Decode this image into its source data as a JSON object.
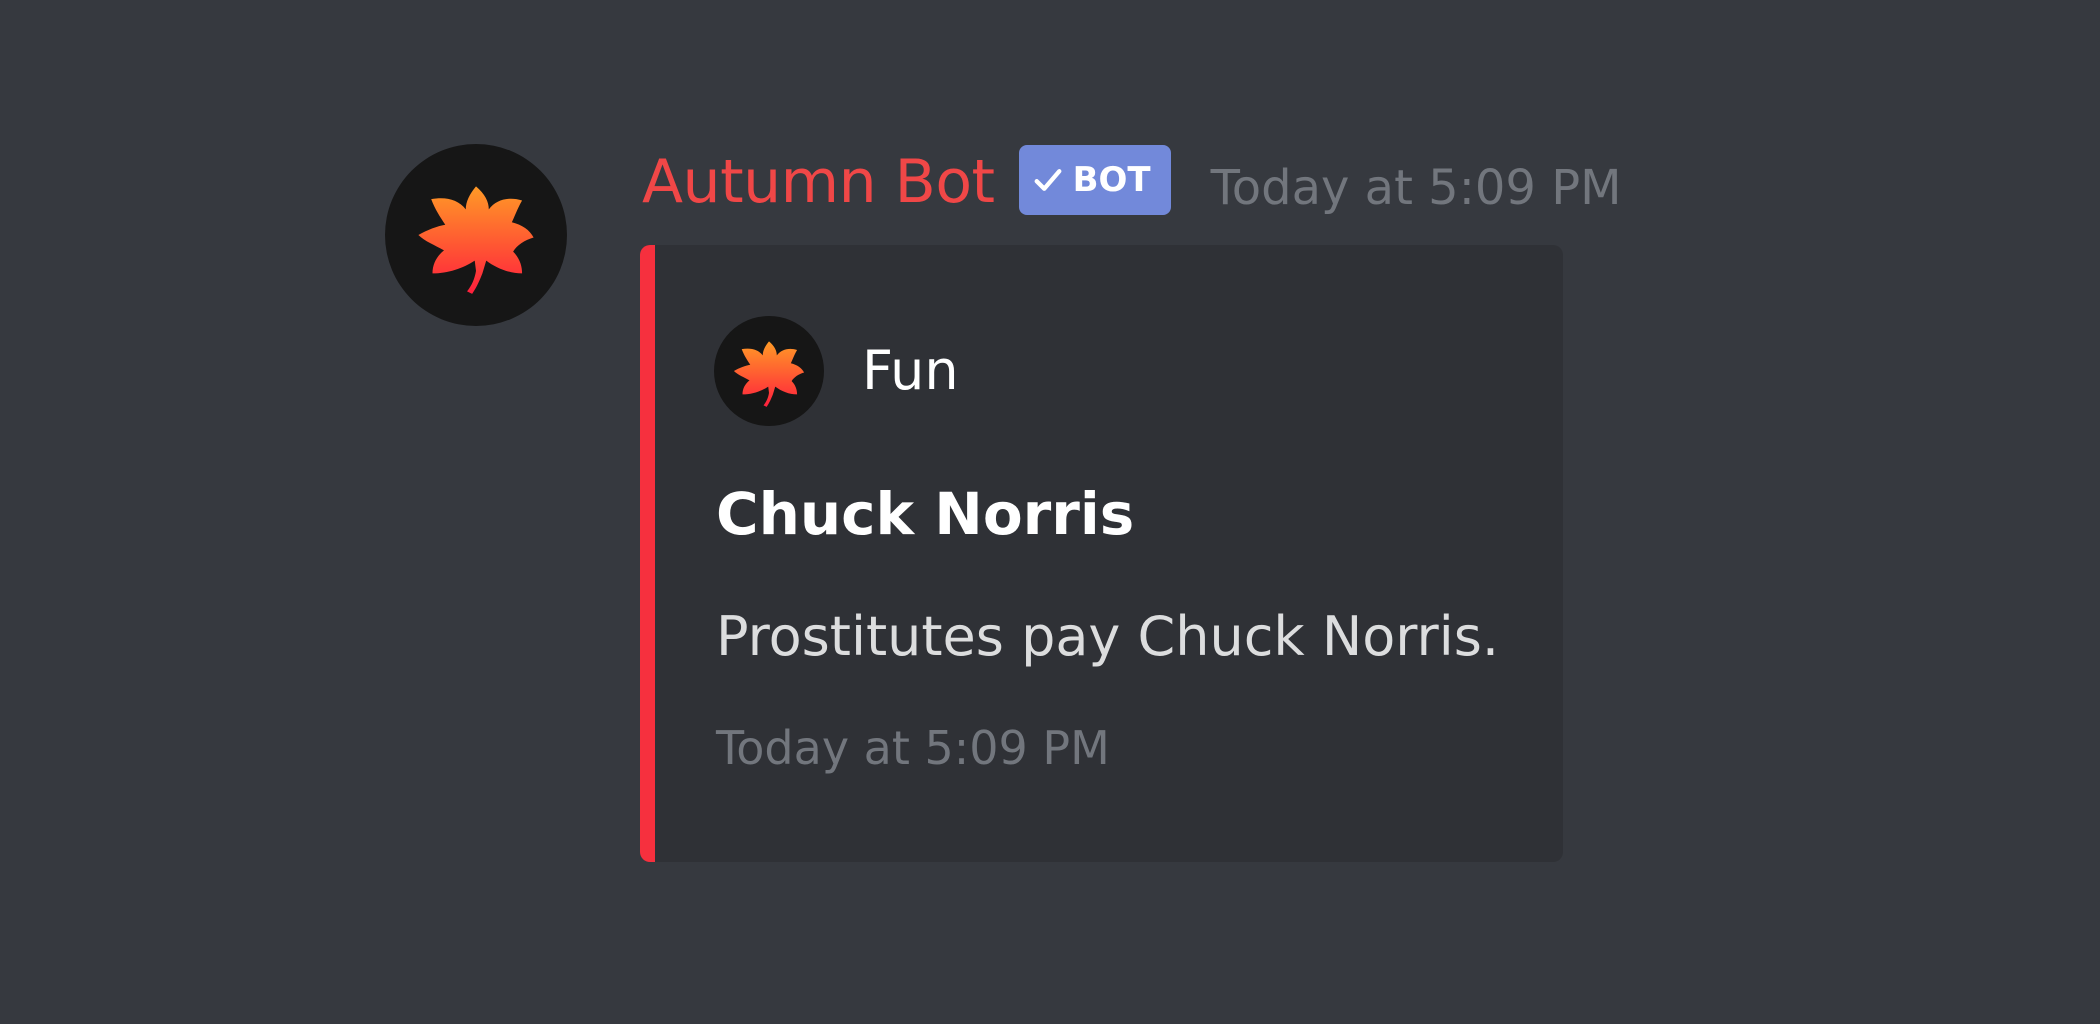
{
  "message": {
    "avatar_icon": "maple-leaf-icon",
    "username": "Autumn Bot",
    "username_color": "#f04747",
    "bot_tag": {
      "icon": "checkmark-icon",
      "label": "BOT",
      "color": "#7289da"
    },
    "timestamp": "Today at 5:09 PM"
  },
  "embed": {
    "accent_color": "#f6303e",
    "author": {
      "icon": "maple-leaf-icon",
      "name": "Fun"
    },
    "title": "Chuck Norris",
    "description": "Prostitutes pay Chuck Norris.",
    "footer_timestamp": "Today at 5:09 PM"
  }
}
